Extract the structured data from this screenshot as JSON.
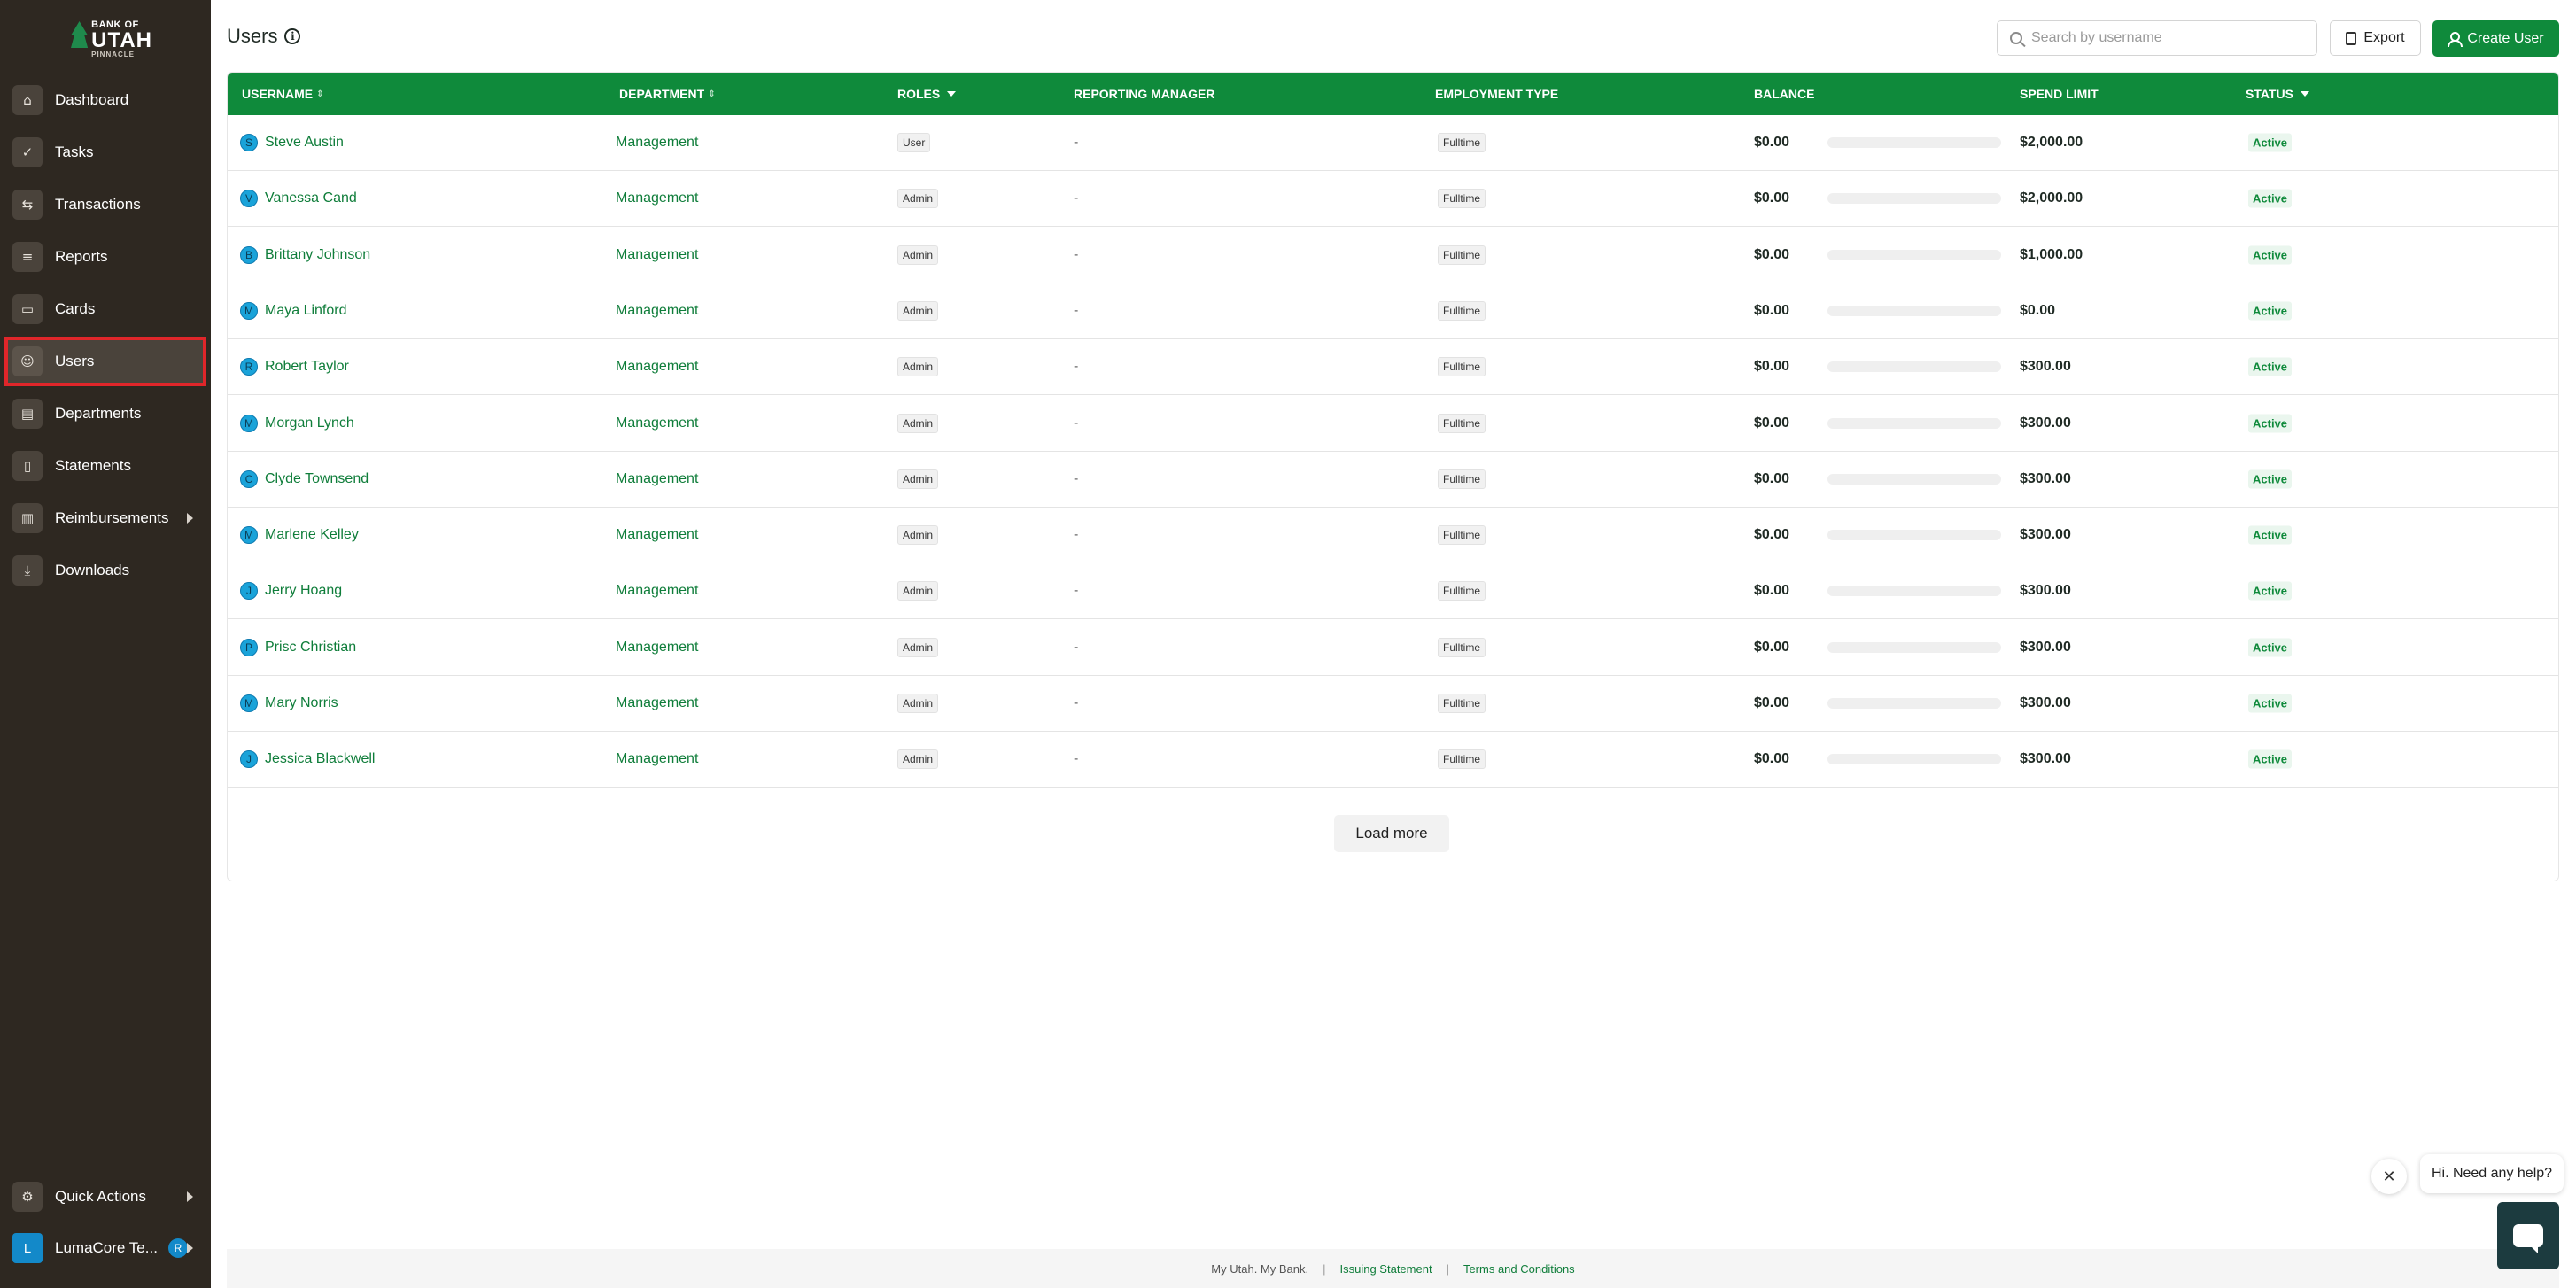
{
  "brand": {
    "line1": "BANK OF",
    "line2": "UTAH",
    "line3": "PINNACLE"
  },
  "sidebar": {
    "items": [
      {
        "label": "Dashboard",
        "icon": "home-icon",
        "glyph": "⌂"
      },
      {
        "label": "Tasks",
        "icon": "check-circle-icon",
        "glyph": "✓"
      },
      {
        "label": "Transactions",
        "icon": "swap-icon",
        "glyph": "⇆"
      },
      {
        "label": "Reports",
        "icon": "report-icon",
        "glyph": "≡"
      },
      {
        "label": "Cards",
        "icon": "card-icon",
        "glyph": "▭"
      },
      {
        "label": "Users",
        "icon": "users-icon",
        "glyph": "☺",
        "active": true
      },
      {
        "label": "Departments",
        "icon": "building-icon",
        "glyph": "▤"
      },
      {
        "label": "Statements",
        "icon": "document-icon",
        "glyph": "▯"
      },
      {
        "label": "Reimbursements",
        "icon": "receipt-icon",
        "glyph": "▥",
        "has_submenu": true
      },
      {
        "label": "Downloads",
        "icon": "download-icon",
        "glyph": "⤓"
      }
    ],
    "quick_actions": {
      "label": "Quick Actions",
      "icon": "lightning-icon",
      "glyph": "⚙"
    },
    "workspace": {
      "avatar": "L",
      "label": "LumaCore Te...",
      "badge": "R"
    }
  },
  "header": {
    "title": "Users",
    "search_placeholder": "Search by username",
    "export_label": "Export",
    "create_label": "Create User"
  },
  "table": {
    "columns": [
      "USERNAME",
      "DEPARTMENT",
      "ROLES",
      "REPORTING MANAGER",
      "EMPLOYMENT TYPE",
      "BALANCE",
      "SPEND LIMIT",
      "STATUS"
    ],
    "rows": [
      {
        "initial": "S",
        "name": "Steve Austin",
        "department": "Management",
        "role": "User",
        "manager": "-",
        "type": "Fulltime",
        "balance": "$0.00",
        "used_fraction": 0,
        "limit": "$2,000.00",
        "status": "Active"
      },
      {
        "initial": "V",
        "name": "Vanessa Cand",
        "department": "Management",
        "role": "Admin",
        "manager": "-",
        "type": "Fulltime",
        "balance": "$0.00",
        "used_fraction": 0,
        "limit": "$2,000.00",
        "status": "Active"
      },
      {
        "initial": "B",
        "name": "Brittany Johnson",
        "department": "Management",
        "role": "Admin",
        "manager": "-",
        "type": "Fulltime",
        "balance": "$0.00",
        "used_fraction": 0,
        "limit": "$1,000.00",
        "status": "Active"
      },
      {
        "initial": "M",
        "name": "Maya Linford",
        "department": "Management",
        "role": "Admin",
        "manager": "-",
        "type": "Fulltime",
        "balance": "$0.00",
        "used_fraction": 0,
        "limit": "$0.00",
        "status": "Active"
      },
      {
        "initial": "R",
        "name": "Robert Taylor",
        "department": "Management",
        "role": "Admin",
        "manager": "-",
        "type": "Fulltime",
        "balance": "$0.00",
        "used_fraction": 0,
        "limit": "$300.00",
        "status": "Active"
      },
      {
        "initial": "M",
        "name": "Morgan Lynch",
        "department": "Management",
        "role": "Admin",
        "manager": "-",
        "type": "Fulltime",
        "balance": "$0.00",
        "used_fraction": 0,
        "limit": "$300.00",
        "status": "Active"
      },
      {
        "initial": "C",
        "name": "Clyde Townsend",
        "department": "Management",
        "role": "Admin",
        "manager": "-",
        "type": "Fulltime",
        "balance": "$0.00",
        "used_fraction": 0,
        "limit": "$300.00",
        "status": "Active"
      },
      {
        "initial": "M",
        "name": "Marlene Kelley",
        "department": "Management",
        "role": "Admin",
        "manager": "-",
        "type": "Fulltime",
        "balance": "$0.00",
        "used_fraction": 0,
        "limit": "$300.00",
        "status": "Active"
      },
      {
        "initial": "J",
        "name": "Jerry Hoang",
        "department": "Management",
        "role": "Admin",
        "manager": "-",
        "type": "Fulltime",
        "balance": "$0.00",
        "used_fraction": 0,
        "limit": "$300.00",
        "status": "Active"
      },
      {
        "initial": "P",
        "name": "Prisc Christian",
        "department": "Management",
        "role": "Admin",
        "manager": "-",
        "type": "Fulltime",
        "balance": "$0.00",
        "used_fraction": 0,
        "limit": "$300.00",
        "status": "Active"
      },
      {
        "initial": "M",
        "name": "Mary Norris",
        "department": "Management",
        "role": "Admin",
        "manager": "-",
        "type": "Fulltime",
        "balance": "$0.00",
        "used_fraction": 0,
        "limit": "$300.00",
        "status": "Active"
      },
      {
        "initial": "J",
        "name": "Jessica Blackwell",
        "department": "Management",
        "role": "Admin",
        "manager": "-",
        "type": "Fulltime",
        "balance": "$0.00",
        "used_fraction": 0,
        "limit": "$300.00",
        "status": "Active"
      }
    ],
    "load_more_label": "Load more"
  },
  "footer": {
    "tagline": "My Utah. My Bank.",
    "link1": "Issuing Statement",
    "link2": "Terms and Conditions"
  },
  "chat": {
    "close_glyph": "✕",
    "greeting": "Hi. Need any help?"
  },
  "colors": {
    "brand_green": "#0f8a3b",
    "sidebar_bg": "#2e2821",
    "active_outline": "#e0262a",
    "avatar_blue": "#1aa3d9"
  }
}
